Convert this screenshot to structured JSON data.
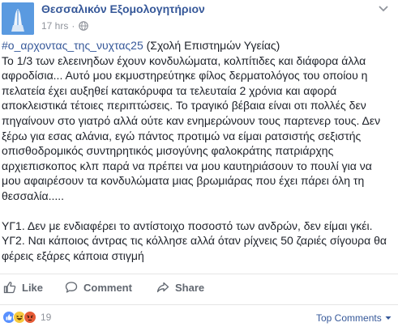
{
  "page": {
    "name": "Θεσσαλικόν Εξομολογητήριον",
    "timestamp": "17 hrs",
    "separator": "·"
  },
  "post": {
    "hashtag": "#ο_αρχοντας_της_νυχτας25",
    "school": " (Σχολή Επιστημών Υγείας)",
    "paragraph1": "Το 1/3 των ελεεινηδων έχουν κονδυλώματα, κολπίτιδες και διάφορα άλλα αφροδίσια... Αυτό μου εκμυστηρεύτηκε φίλος δερματολόγος του οποίου η πελατεία έχει αυξηθεί κατακόρυφα τα τελευταία 2 χρόνια και αφορά αποκλειστικά τέτοιες περιπτώσεις. Το τραγικό βέβαια είναι οτι πολλές δεν πηγαίνουν στο γιατρό αλλά ούτε καν ενημερώνουν τους παρτενερ τους. Δεν ξέρω για εσας αλάνια, εγώ πάντος προτιμώ να είμαι ρατσιστής σεξιστής οπισθοδρομικός συντηρητικός μισογύνης φαλοκράτης πατριάρχης αρχιεπισκοπος κλπ παρά να πρέπει να μου καυτηριάσουν το πουλί για να μου αφαιρέσουν τα κονδυλώματα μιας βρωμιάρας που έχει πάρει όλη τη θεσσαλία.....",
    "ps1": "ΥΓ1. Δεν με ενδιαφέρει το αντίστοιχο ποσοστό των ανδρών, δεν είμαι γκέι.",
    "ps2": "ΥΓ2. Ναι κάποιος άντρας τις κόλλησε αλλά όταν ρίχνεις 50 ζαριές σίγουρα θα φέρεις εξάρες κάποια στιγμή"
  },
  "actions": {
    "like": "Like",
    "comment": "Comment",
    "share": "Share"
  },
  "reactions": {
    "count": "19",
    "types": [
      "like-icon",
      "haha-icon",
      "angry-icon"
    ]
  },
  "comments": {
    "sort_label": "Top Comments"
  },
  "colors": {
    "link": "#365899",
    "text": "#1d2129",
    "muted": "#90949c",
    "action": "#616770",
    "like": "#5890ff",
    "haha": "#f7c93d",
    "angry": "#e55a35"
  }
}
